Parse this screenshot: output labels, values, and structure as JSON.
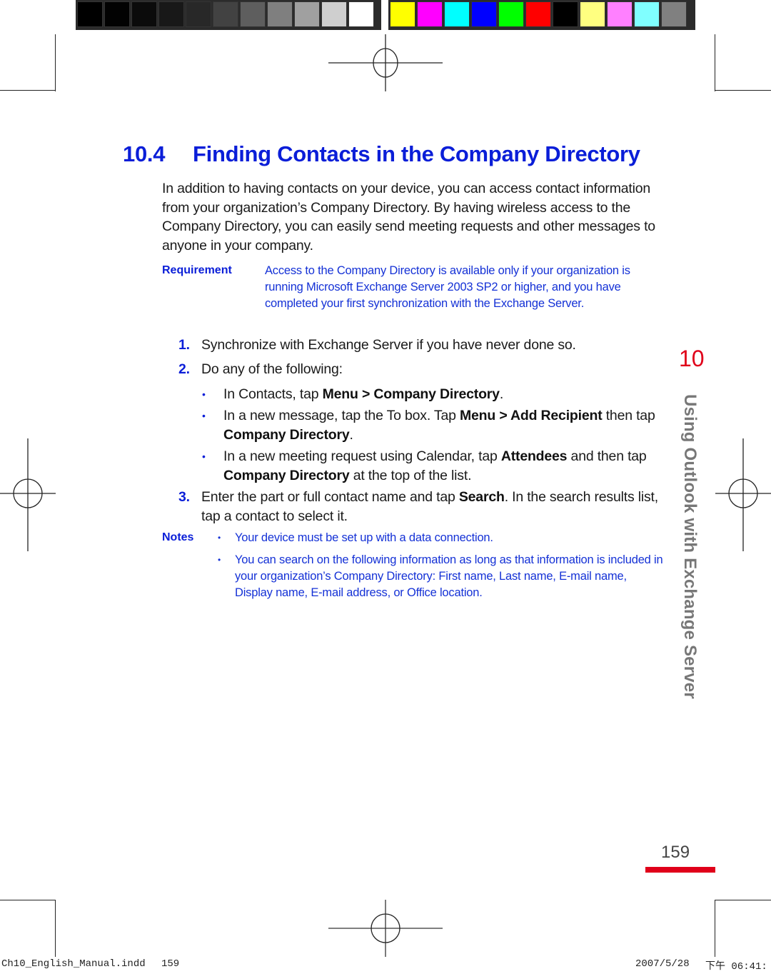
{
  "color_bars": {
    "grayscale": [
      "#000000",
      "#020202",
      "#0b0b0b",
      "#181818",
      "#282828",
      "#424242",
      "#5e5e5e",
      "#7f7f7f",
      "#a0a0a0",
      "#cfcfcf",
      "#ffffff"
    ],
    "process": [
      "#ffff00",
      "#ff00ff",
      "#00ffff",
      "#0000ff",
      "#00ff00",
      "#ff0000",
      "#000000",
      "#ffff80",
      "#ff80ff",
      "#80ffff",
      "#808080"
    ]
  },
  "section": {
    "number": "10.4",
    "title": "Finding Contacts in the Company Directory"
  },
  "intro": "In addition to having contacts on your device, you can access contact information from your organization’s Company Directory. By having wireless access to the Company Directory, you can easily send meeting requests and other messages to anyone in your company.",
  "requirement": {
    "label": "Requirement",
    "text": "Access to the Company Directory is available only if your organization is running Microsoft Exchange Server 2003 SP2 or higher, and you have completed your first synchronization with the Exchange Server."
  },
  "steps": [
    {
      "num": "1.",
      "text": "Synchronize with Exchange Server if you have never done so."
    },
    {
      "num": "2.",
      "text": "Do any of the following:"
    },
    {
      "num": "3.",
      "pre": "Enter the part or full contact name and tap ",
      "bold": "Search",
      "post": ". In the search results list, tap a contact to select it."
    }
  ],
  "bullets": [
    {
      "pre": "In Contacts, tap ",
      "bold1": "Menu > Company Directory",
      "mid": ".",
      "bold2": "",
      "post": ""
    },
    {
      "pre": "In a new message, tap the To box. Tap ",
      "bold1": "Menu > Add Recipient",
      "mid": " then tap ",
      "bold2": "Company Directory",
      "post": "."
    },
    {
      "pre": "In a new meeting request using Calendar, tap ",
      "bold1": "Attendees",
      "mid": " and then tap ",
      "bold2": "Company Directory",
      "post": " at the top of the list."
    }
  ],
  "notes": {
    "label": "Notes",
    "items": [
      "Your device must be set up with a data connection.",
      "You can search on the following information as long as that information is included in your organization’s Company Directory: First name, Last name, E-mail name, Display name, E-mail address, or Office location."
    ]
  },
  "chapter": {
    "number": "10",
    "title": "Using Outlook with Exchange Server"
  },
  "page_number": "159",
  "slug": {
    "file": "Ch10_English_Manual.indd",
    "page": "159",
    "date": "2007/5/28",
    "time": "下午 06:41:"
  },
  "bullet_glyph": "•"
}
